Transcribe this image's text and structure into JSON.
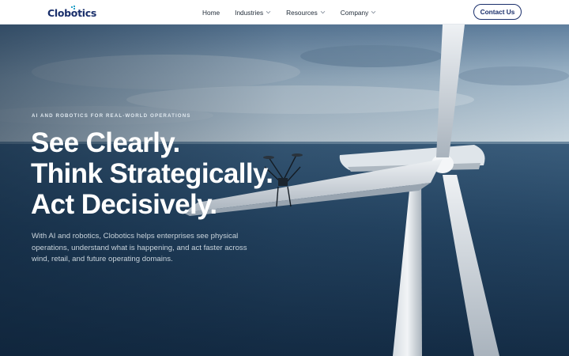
{
  "header": {
    "logo_text": "Clobotics",
    "nav": [
      {
        "label": "Home",
        "has_dropdown": false
      },
      {
        "label": "Industries",
        "has_dropdown": true
      },
      {
        "label": "Resources",
        "has_dropdown": true
      },
      {
        "label": "Company",
        "has_dropdown": true
      }
    ],
    "contact_label": "Contact Us"
  },
  "hero": {
    "eyebrow": "AI AND ROBOTICS FOR REAL-WORLD OPERATIONS",
    "headline": [
      "See Clearly.",
      "Think Strategically.",
      "Act Decisively."
    ],
    "subtext": "With AI and robotics, Clobotics helps enterprises see physical operations, understand what is happening, and act faster across wind, retail, and future operating domains."
  },
  "colors": {
    "brand_navy": "#1a2f6b",
    "brand_accent": "#2aa3c9",
    "header_bg": "#ffffff",
    "hero_text": "#ffffff"
  },
  "icons": {
    "chevron": "chevron-down-icon",
    "logo_mark": "logo-mark-icon"
  }
}
